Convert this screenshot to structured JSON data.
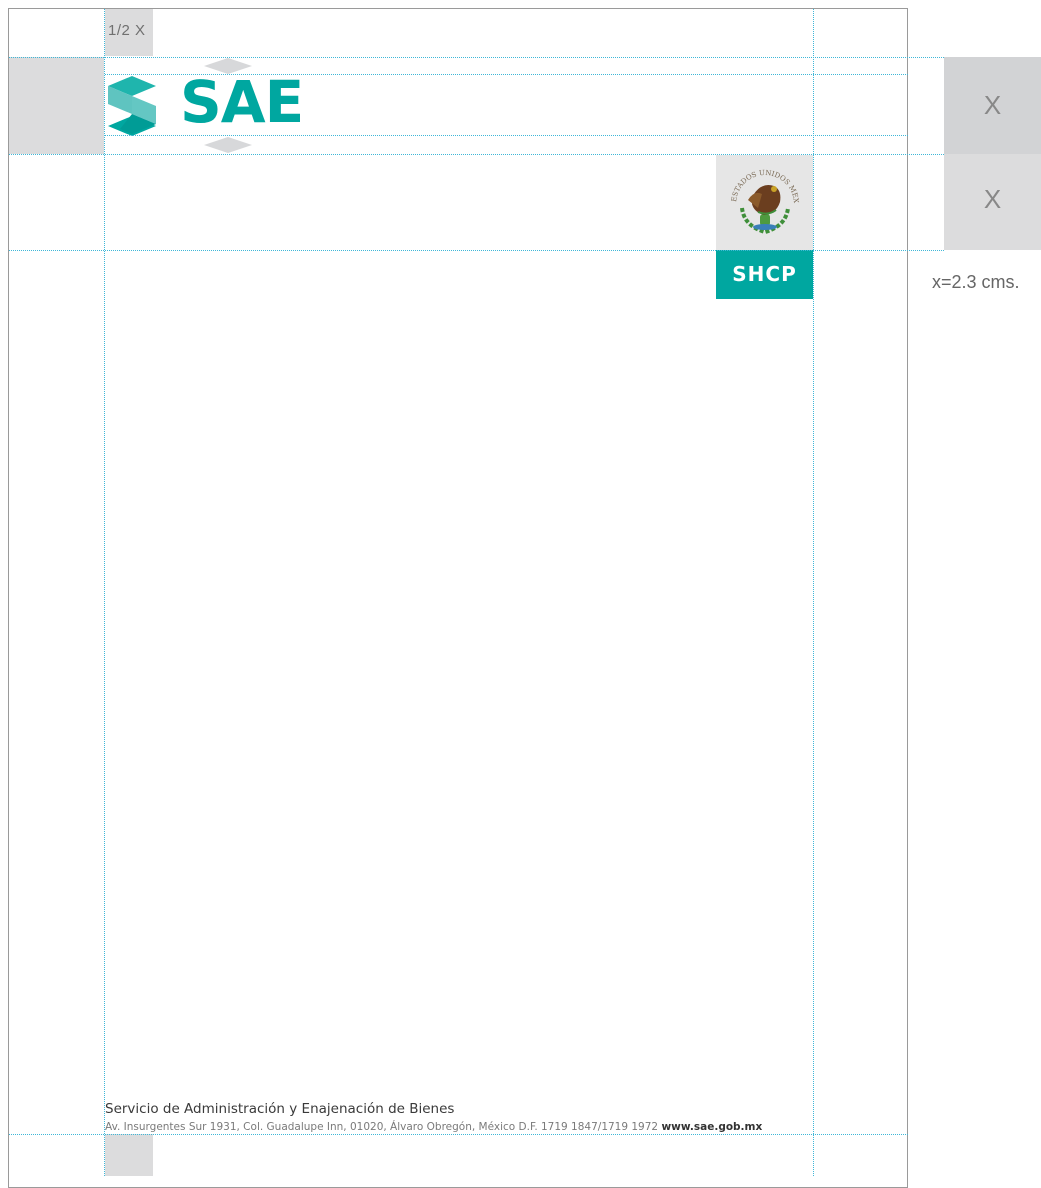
{
  "guides": {
    "half_x_label": "1/2 X",
    "x_label_top": "X",
    "x_label_bottom": "X",
    "unit_label": "x=2.3 cms."
  },
  "logo": {
    "brand_text": "SAE"
  },
  "agency": {
    "seal_text": "ESTADOS UNIDOS MEXICANOS",
    "badge_text": "SHCP"
  },
  "footer": {
    "org_name": "Servicio de Administración y Enajenación de Bienes",
    "address": "Av. Insurgentes Sur 1931, Col. Guadalupe Inn, 01020, Álvaro Obregón, México D.F. 1719 1847/1719 1972",
    "website": "www.sae.gob.mx"
  },
  "colors": {
    "brand_teal": "#00a7a0",
    "guide_blue": "#3fb7d8",
    "margin_gray": "#dcdcdd"
  }
}
